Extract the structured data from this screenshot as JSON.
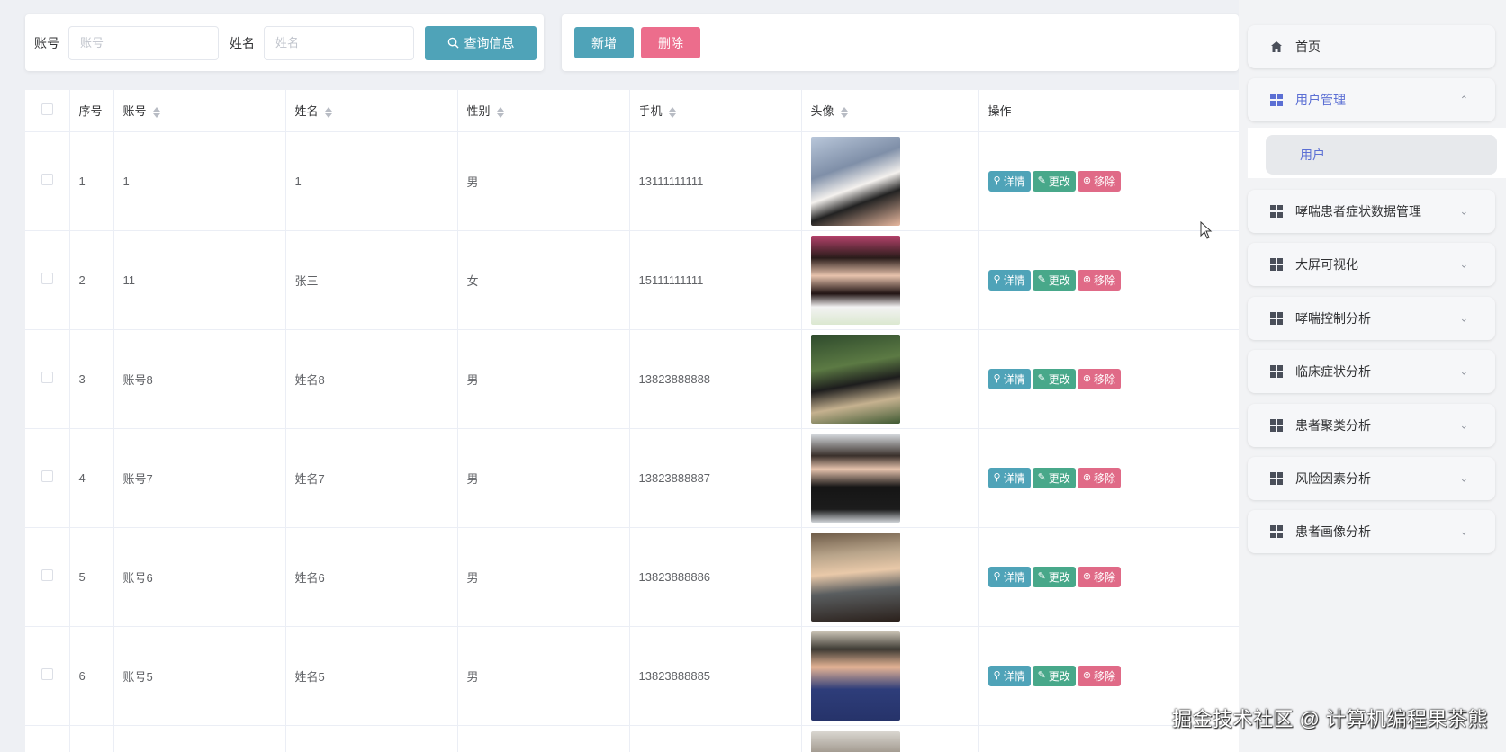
{
  "search": {
    "account_label": "账号",
    "account_placeholder": "账号",
    "name_label": "姓名",
    "name_placeholder": "姓名",
    "query_button": "查询信息"
  },
  "actions": {
    "add_button": "新增",
    "delete_button": "删除"
  },
  "table": {
    "headers": {
      "index": "序号",
      "account": "账号",
      "name": "姓名",
      "gender": "性别",
      "phone": "手机",
      "avatar": "头像",
      "ops": "操作"
    },
    "op_labels": {
      "detail": "详情",
      "edit": "更改",
      "remove": "移除"
    },
    "rows": [
      {
        "index": "1",
        "account": "1",
        "name": "1",
        "gender": "男",
        "phone": "13111111111"
      },
      {
        "index": "2",
        "account": "11",
        "name": "张三",
        "gender": "女",
        "phone": "15111111111"
      },
      {
        "index": "3",
        "account": "账号8",
        "name": "姓名8",
        "gender": "男",
        "phone": "13823888888"
      },
      {
        "index": "4",
        "account": "账号7",
        "name": "姓名7",
        "gender": "男",
        "phone": "13823888887"
      },
      {
        "index": "5",
        "account": "账号6",
        "name": "姓名6",
        "gender": "男",
        "phone": "13823888886"
      },
      {
        "index": "6",
        "account": "账号5",
        "name": "姓名5",
        "gender": "男",
        "phone": "13823888885"
      }
    ]
  },
  "sidebar": {
    "home": "首页",
    "user_mgmt": "用户管理",
    "user_sub": "用户",
    "items": [
      "哮喘患者症状数据管理",
      "大屏可视化",
      "哮喘控制分析",
      "临床症状分析",
      "患者聚类分析",
      "风险因素分析",
      "患者画像分析"
    ]
  },
  "watermark": "掘金技术社区 @ 计算机编程果茶熊",
  "colors": {
    "primary": "#4fa3b8",
    "danger": "#ec6d8c",
    "edit": "#48a88a",
    "active_menu": "#5b6fd4"
  }
}
